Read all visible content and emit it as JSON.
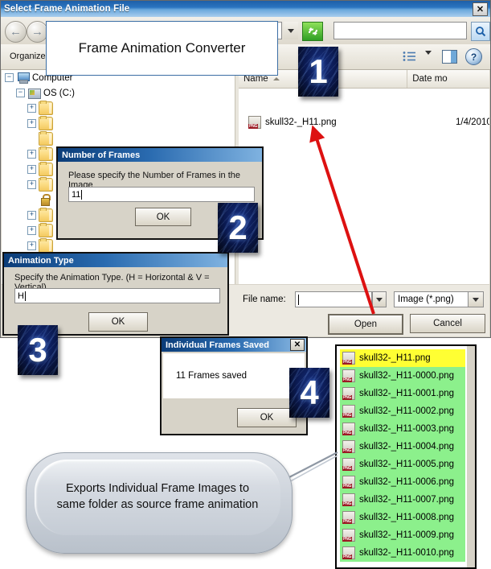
{
  "window": {
    "title": "Select Frame Animation File",
    "close_label": "✕"
  },
  "toolbar": {
    "back_icon": "back-arrow-icon",
    "forward_icon": "forward-arrow-icon",
    "address_value": "",
    "address_dropdown_icon": "chevron-down-icon",
    "refresh_icon": "refresh-icon",
    "search_placeholder": "",
    "search_icon": "search-icon",
    "organize_label": "Organize",
    "views_icon": "views-list-icon",
    "views_caret_icon": "chevron-down-icon",
    "preview_pane_icon": "preview-pane-icon",
    "help_label": "?"
  },
  "title_callout": {
    "text": "Frame Animation Converter"
  },
  "nav_pane": {
    "tree": [
      {
        "label": "Computer",
        "icon": "computer-icon",
        "expander": "−",
        "indent": 4,
        "type": "computer"
      },
      {
        "label": "OS (C:)",
        "icon": "drive-icon",
        "expander": "−",
        "indent": 18,
        "type": "drive"
      },
      {
        "label": "",
        "icon": "folder-icon",
        "expander": "+",
        "indent": 32,
        "type": "folder"
      },
      {
        "label": "",
        "icon": "folder-icon",
        "expander": "+",
        "indent": 32,
        "type": "folder"
      },
      {
        "label": "",
        "icon": "folder-icon",
        "expander": "",
        "indent": 32,
        "type": "folder"
      },
      {
        "label": "",
        "icon": "folder-icon",
        "expander": "+",
        "indent": 32,
        "type": "folder"
      },
      {
        "label": "",
        "icon": "folder-icon",
        "expander": "+",
        "indent": 32,
        "type": "folder"
      },
      {
        "label": "",
        "icon": "folder-icon",
        "expander": "+",
        "indent": 32,
        "type": "folder"
      },
      {
        "label": "",
        "icon": "locked-folder-icon",
        "expander": "",
        "indent": 32,
        "type": "lockfolder"
      },
      {
        "label": "",
        "icon": "folder-icon",
        "expander": "+",
        "indent": 32,
        "type": "folder"
      },
      {
        "label": "",
        "icon": "folder-icon",
        "expander": "+",
        "indent": 32,
        "type": "folder"
      },
      {
        "label": "",
        "icon": "folder-icon",
        "expander": "+",
        "indent": 32,
        "type": "folder"
      },
      {
        "label": "",
        "icon": "folder-icon",
        "expander": "+",
        "indent": 32,
        "type": "folder"
      }
    ]
  },
  "file_pane": {
    "columns": [
      {
        "key": "name",
        "label": "Name",
        "sorted": true
      },
      {
        "key": "date",
        "label": "Date mo"
      }
    ],
    "rows": [
      {
        "icon": "png-file-icon",
        "name": "skull32-_H11.png",
        "date": "1/4/2010"
      }
    ]
  },
  "footer": {
    "filename_label": "File name:",
    "filename_value": "",
    "filename_dropdown_icon": "chevron-down-icon",
    "filter_value": "Image (*.png)",
    "filter_dropdown_icon": "chevron-down-icon",
    "open_label": "Open",
    "cancel_label": "Cancel"
  },
  "dialogs": {
    "number_of_frames": {
      "title": "Number of Frames",
      "prompt": "Please specify the Number of Frames in the Image",
      "value": "11",
      "ok_label": "OK"
    },
    "animation_type": {
      "title": "Animation Type",
      "prompt": "Specify the Animation Type. (H = Horizontal & V = Vertical)",
      "value": "H",
      "ok_label": "OK"
    },
    "frames_saved": {
      "title": "Individual Frames Saved",
      "close_label": "✕",
      "message": "11 Frames saved",
      "ok_label": "OK"
    }
  },
  "badges": [
    {
      "number": "1"
    },
    {
      "number": "2"
    },
    {
      "number": "3"
    },
    {
      "number": "4"
    }
  ],
  "results_panel": {
    "rows": [
      {
        "icon": "png-file-icon",
        "name": "skull32-_H11.png",
        "selected": true
      },
      {
        "icon": "png-file-icon",
        "name": "skull32-_H11-0000.png",
        "selected": false
      },
      {
        "icon": "png-file-icon",
        "name": "skull32-_H11-0001.png",
        "selected": false
      },
      {
        "icon": "png-file-icon",
        "name": "skull32-_H11-0002.png",
        "selected": false
      },
      {
        "icon": "png-file-icon",
        "name": "skull32-_H11-0003.png",
        "selected": false
      },
      {
        "icon": "png-file-icon",
        "name": "skull32-_H11-0004.png",
        "selected": false
      },
      {
        "icon": "png-file-icon",
        "name": "skull32-_H11-0005.png",
        "selected": false
      },
      {
        "icon": "png-file-icon",
        "name": "skull32-_H11-0006.png",
        "selected": false
      },
      {
        "icon": "png-file-icon",
        "name": "skull32-_H11-0007.png",
        "selected": false
      },
      {
        "icon": "png-file-icon",
        "name": "skull32-_H11-0008.png",
        "selected": false
      },
      {
        "icon": "png-file-icon",
        "name": "skull32-_H11-0009.png",
        "selected": false
      },
      {
        "icon": "png-file-icon",
        "name": "skull32-_H11-0010.png",
        "selected": false
      }
    ],
    "highlight_color": "#ffff33",
    "row_color": "#8cf08c"
  },
  "export_callout": {
    "text": "Exports Individual Frame Images to same folder as source frame animation"
  },
  "annotation": {
    "arrow_color": "#dd1111"
  }
}
